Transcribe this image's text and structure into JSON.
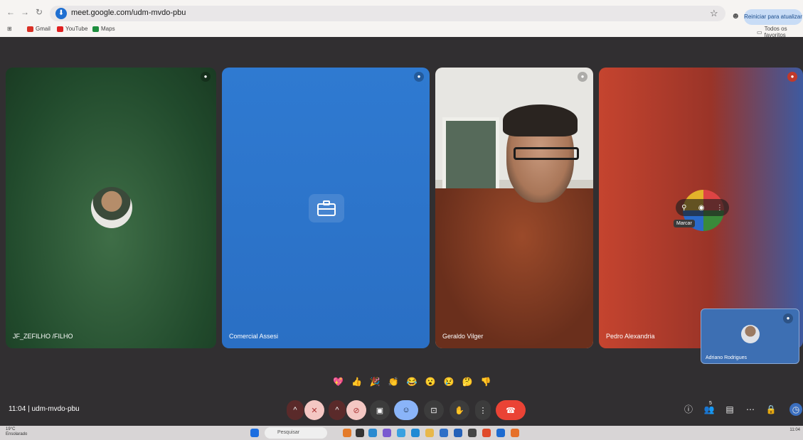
{
  "browser": {
    "url": "meet.google.com/udm-mvdo-pbu",
    "update_label": "Reiniciar para atualizar",
    "bookmarks": [
      {
        "label": "Gmail",
        "color": "#d93025"
      },
      {
        "label": "YouTube",
        "color": "#e02020"
      },
      {
        "label": "Maps",
        "color": "#1e8e3e"
      }
    ],
    "all_bookmarks_label": "Todos os favoritos"
  },
  "tiles": [
    {
      "name": "JF_ZEFILHO /FILHO"
    },
    {
      "name": "Comercial Assesi"
    },
    {
      "name": "Geraldo Vilger"
    },
    {
      "name": "Pedro Alexandria",
      "tooltip": "Marcar"
    }
  ],
  "self_view": {
    "name": "Adriano Rodrigues"
  },
  "reactions": [
    "💖",
    "👍",
    "🎉",
    "👏",
    "😂",
    "😮",
    "😢",
    "🤔",
    "👎"
  ],
  "meeting": {
    "time": "11:04",
    "code": "udm-mvdo-pbu",
    "participants_count": "5"
  },
  "taskbar": {
    "temperature": "19°C",
    "weather": "Ensolarado",
    "search_placeholder": "Pesquisar",
    "time": "11:04"
  }
}
